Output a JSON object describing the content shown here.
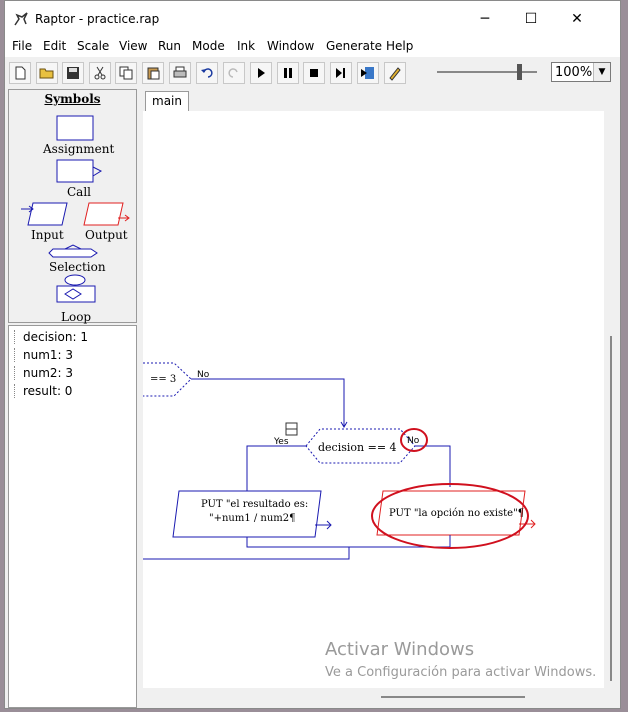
{
  "window": {
    "title": "Raptor - practice.rap",
    "minimize": "─",
    "maximize": "☐",
    "close": "✕"
  },
  "menu": [
    "File",
    "Edit",
    "Scale",
    "View",
    "Run",
    "Mode",
    "Ink",
    "Window",
    "Generate",
    "Help"
  ],
  "toolbar": {
    "icons": [
      "new-file-icon",
      "open-folder-icon",
      "save-icon",
      "cut-icon",
      "copy-icon",
      "paste-icon",
      "print-icon",
      "undo-icon",
      "redo-icon",
      "play-icon",
      "pause-icon",
      "stop-icon",
      "step-icon",
      "run-to-completion-icon",
      "pen-icon"
    ],
    "zoom": "100%"
  },
  "symbols": {
    "title": "Symbols",
    "assignment": "Assignment",
    "call": "Call",
    "input": "Input",
    "output": "Output",
    "selection": "Selection",
    "loop": "Loop"
  },
  "variables": [
    {
      "text": "decision: 1"
    },
    {
      "text": "num1: 3"
    },
    {
      "text": "num2: 3"
    },
    {
      "text": "result: 0"
    }
  ],
  "tabs": [
    "main"
  ],
  "flowchart": {
    "partial_condition": "== 3",
    "no_label_1": "No",
    "yes_label": "Yes",
    "condition": "decision == 4",
    "no_label_2": "No",
    "put_left_line1": "PUT \"el resultado es:",
    "put_left_line2": "\"+num1 / num2¶",
    "put_right": "PUT \"la opción no existe\"¶"
  },
  "watermark": {
    "line1": "Activar Windows",
    "line2": "Ve a Configuración para activar Windows."
  },
  "colors": {
    "flow_blue": "#1a1ab0",
    "highlight_red": "#d0101e",
    "output_red": "#e02020"
  }
}
